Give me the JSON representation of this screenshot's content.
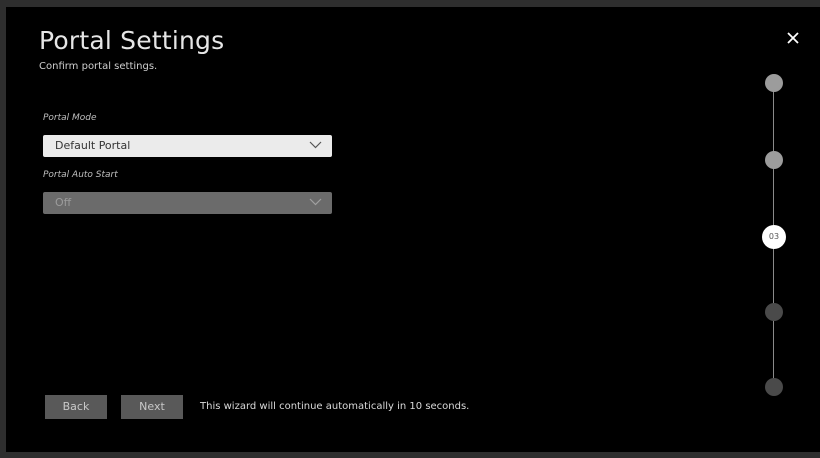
{
  "header": {
    "title": "Portal Settings",
    "subtitle": "Confirm portal settings.",
    "close_icon": "close-icon"
  },
  "fields": {
    "portal_mode": {
      "label": "Portal Mode",
      "value": "Default Portal",
      "state": "active"
    },
    "portal_auto_start": {
      "label": "Portal Auto Start",
      "value": "Off",
      "state": "disabled"
    }
  },
  "footer": {
    "back_label": "Back",
    "next_label": "Next",
    "notice": "This wizard will continue automatically in 10 seconds."
  },
  "stepper": {
    "current_step_label": "03",
    "steps": [
      "completed",
      "completed",
      "current",
      "upcoming",
      "upcoming"
    ]
  },
  "colors": {
    "background": "#000000",
    "dropdown_active": "#ebebeb",
    "dropdown_disabled": "#6b6b6b",
    "button": "#595959",
    "step_done": "#9c9c9c",
    "step_upcoming": "#4a4a4a"
  }
}
